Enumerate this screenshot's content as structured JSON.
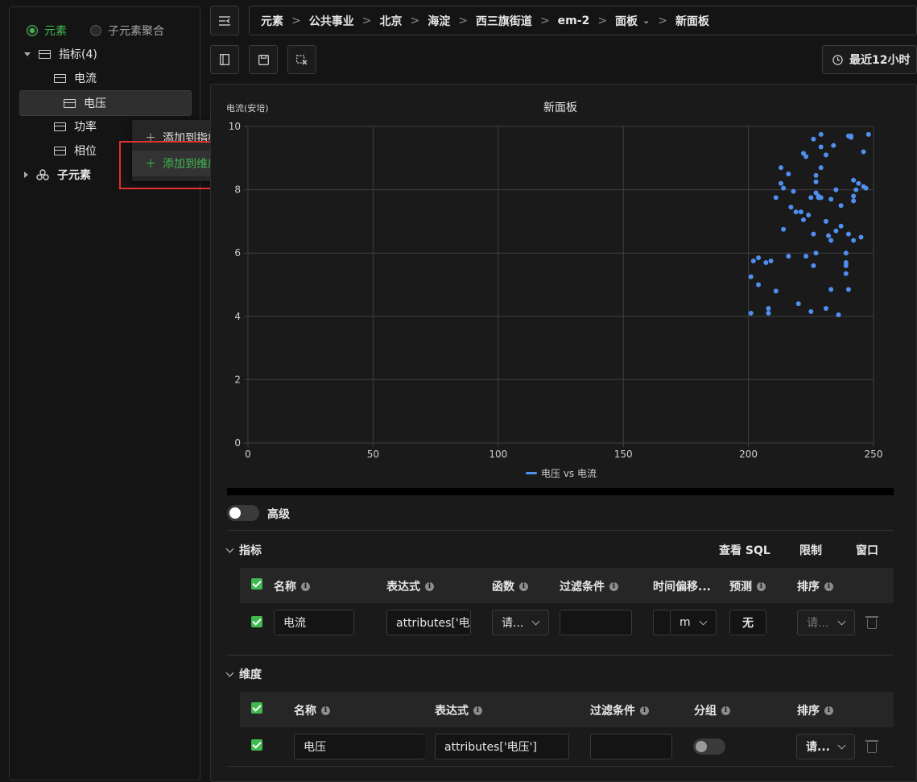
{
  "sidebar": {
    "mode_element": "元素",
    "mode_sub_agg": "子元素聚合",
    "metrics_group": "指标(4)",
    "metrics": [
      "电流",
      "电压",
      "功率",
      "相位"
    ],
    "sub_elements": "子元素"
  },
  "context_menu": {
    "add_to_metric": "添加到指标",
    "add_to_dimension": "添加到维度"
  },
  "breadcrumb": [
    "元素",
    "公共事业",
    "北京",
    "海淀",
    "西三旗街道",
    "em-2",
    "面板",
    "新面板"
  ],
  "time_range": "最近12小时",
  "chart_data": {
    "type": "scatter",
    "title": "新面板",
    "ylabel": "电流(安培)",
    "xlabel": "",
    "xlim": [
      0,
      250
    ],
    "ylim": [
      0,
      10
    ],
    "x_ticks": [
      "0",
      "50",
      "100",
      "150",
      "200",
      "250"
    ],
    "y_ticks": [
      "0",
      "2",
      "4",
      "6",
      "8",
      "10"
    ],
    "grid": true,
    "legend": "bottom",
    "series": [
      {
        "name": "电压 vs 电流",
        "color": "#4f8ff0",
        "points": [
          [
            201,
            4.1
          ],
          [
            201,
            5.25
          ],
          [
            202,
            5.75
          ],
          [
            204,
            5.0
          ],
          [
            204,
            5.85
          ],
          [
            207,
            5.7
          ],
          [
            208,
            4.1
          ],
          [
            208,
            4.25
          ],
          [
            209,
            5.75
          ],
          [
            211,
            7.75
          ],
          [
            211,
            4.8
          ],
          [
            213,
            8.7
          ],
          [
            213,
            8.2
          ],
          [
            214,
            6.75
          ],
          [
            214,
            8.05
          ],
          [
            216,
            8.5
          ],
          [
            216,
            5.9
          ],
          [
            217,
            7.45
          ],
          [
            218,
            7.95
          ],
          [
            219,
            7.3
          ],
          [
            220,
            4.4
          ],
          [
            221,
            7.3
          ],
          [
            222,
            7.05
          ],
          [
            222,
            9.15
          ],
          [
            223,
            9.05
          ],
          [
            223,
            5.9
          ],
          [
            224,
            7.2
          ],
          [
            225,
            7.75
          ],
          [
            225,
            4.15
          ],
          [
            226,
            9.6
          ],
          [
            226,
            6.6
          ],
          [
            226,
            5.6
          ],
          [
            227,
            8.45
          ],
          [
            227,
            8.25
          ],
          [
            227,
            7.9
          ],
          [
            227,
            6.0
          ],
          [
            228,
            7.8
          ],
          [
            228,
            7.75
          ],
          [
            229,
            9.75
          ],
          [
            229,
            9.35
          ],
          [
            229,
            8.7
          ],
          [
            229,
            7.75
          ],
          [
            231,
            9.1
          ],
          [
            231,
            7.0
          ],
          [
            231,
            4.25
          ],
          [
            232,
            6.55
          ],
          [
            233,
            6.4
          ],
          [
            233,
            7.7
          ],
          [
            233,
            4.85
          ],
          [
            234,
            9.4
          ],
          [
            235,
            8.0
          ],
          [
            235,
            6.7
          ],
          [
            236,
            4.05
          ],
          [
            237,
            7.5
          ],
          [
            237,
            6.85
          ],
          [
            239,
            6.0
          ],
          [
            239,
            5.7
          ],
          [
            239,
            5.6
          ],
          [
            239,
            5.35
          ],
          [
            240,
            9.7
          ],
          [
            240,
            6.6
          ],
          [
            240,
            4.85
          ],
          [
            241,
            9.65
          ],
          [
            241,
            9.7
          ],
          [
            242,
            8.3
          ],
          [
            242,
            7.8
          ],
          [
            242,
            7.65
          ],
          [
            242,
            6.4
          ],
          [
            243,
            8.0
          ],
          [
            244,
            8.2
          ],
          [
            245,
            6.5
          ],
          [
            246,
            9.2
          ],
          [
            246,
            8.1
          ],
          [
            247,
            8.05
          ],
          [
            248,
            9.75
          ]
        ]
      }
    ]
  },
  "advanced_label": "高级",
  "metrics_section": {
    "title": "指标",
    "view_sql": "查看 SQL",
    "limit": "限制",
    "window": "窗口",
    "headers": [
      "名称",
      "表达式",
      "函数",
      "过滤条件",
      "时间偏移...",
      "预测",
      "排序"
    ],
    "row": {
      "name": "电流",
      "expression": "attributes['电流']",
      "function": "请...",
      "filter": "",
      "offset_unit": "m",
      "forecast": "无",
      "sort_placeholder": "请..."
    }
  },
  "dimensions_section": {
    "title": "维度",
    "headers": [
      "名称",
      "表达式",
      "过滤条件",
      "分组",
      "排序"
    ],
    "row": {
      "name": "电压",
      "expression": "attributes['电压']",
      "filter": "",
      "sort": "请..."
    }
  }
}
